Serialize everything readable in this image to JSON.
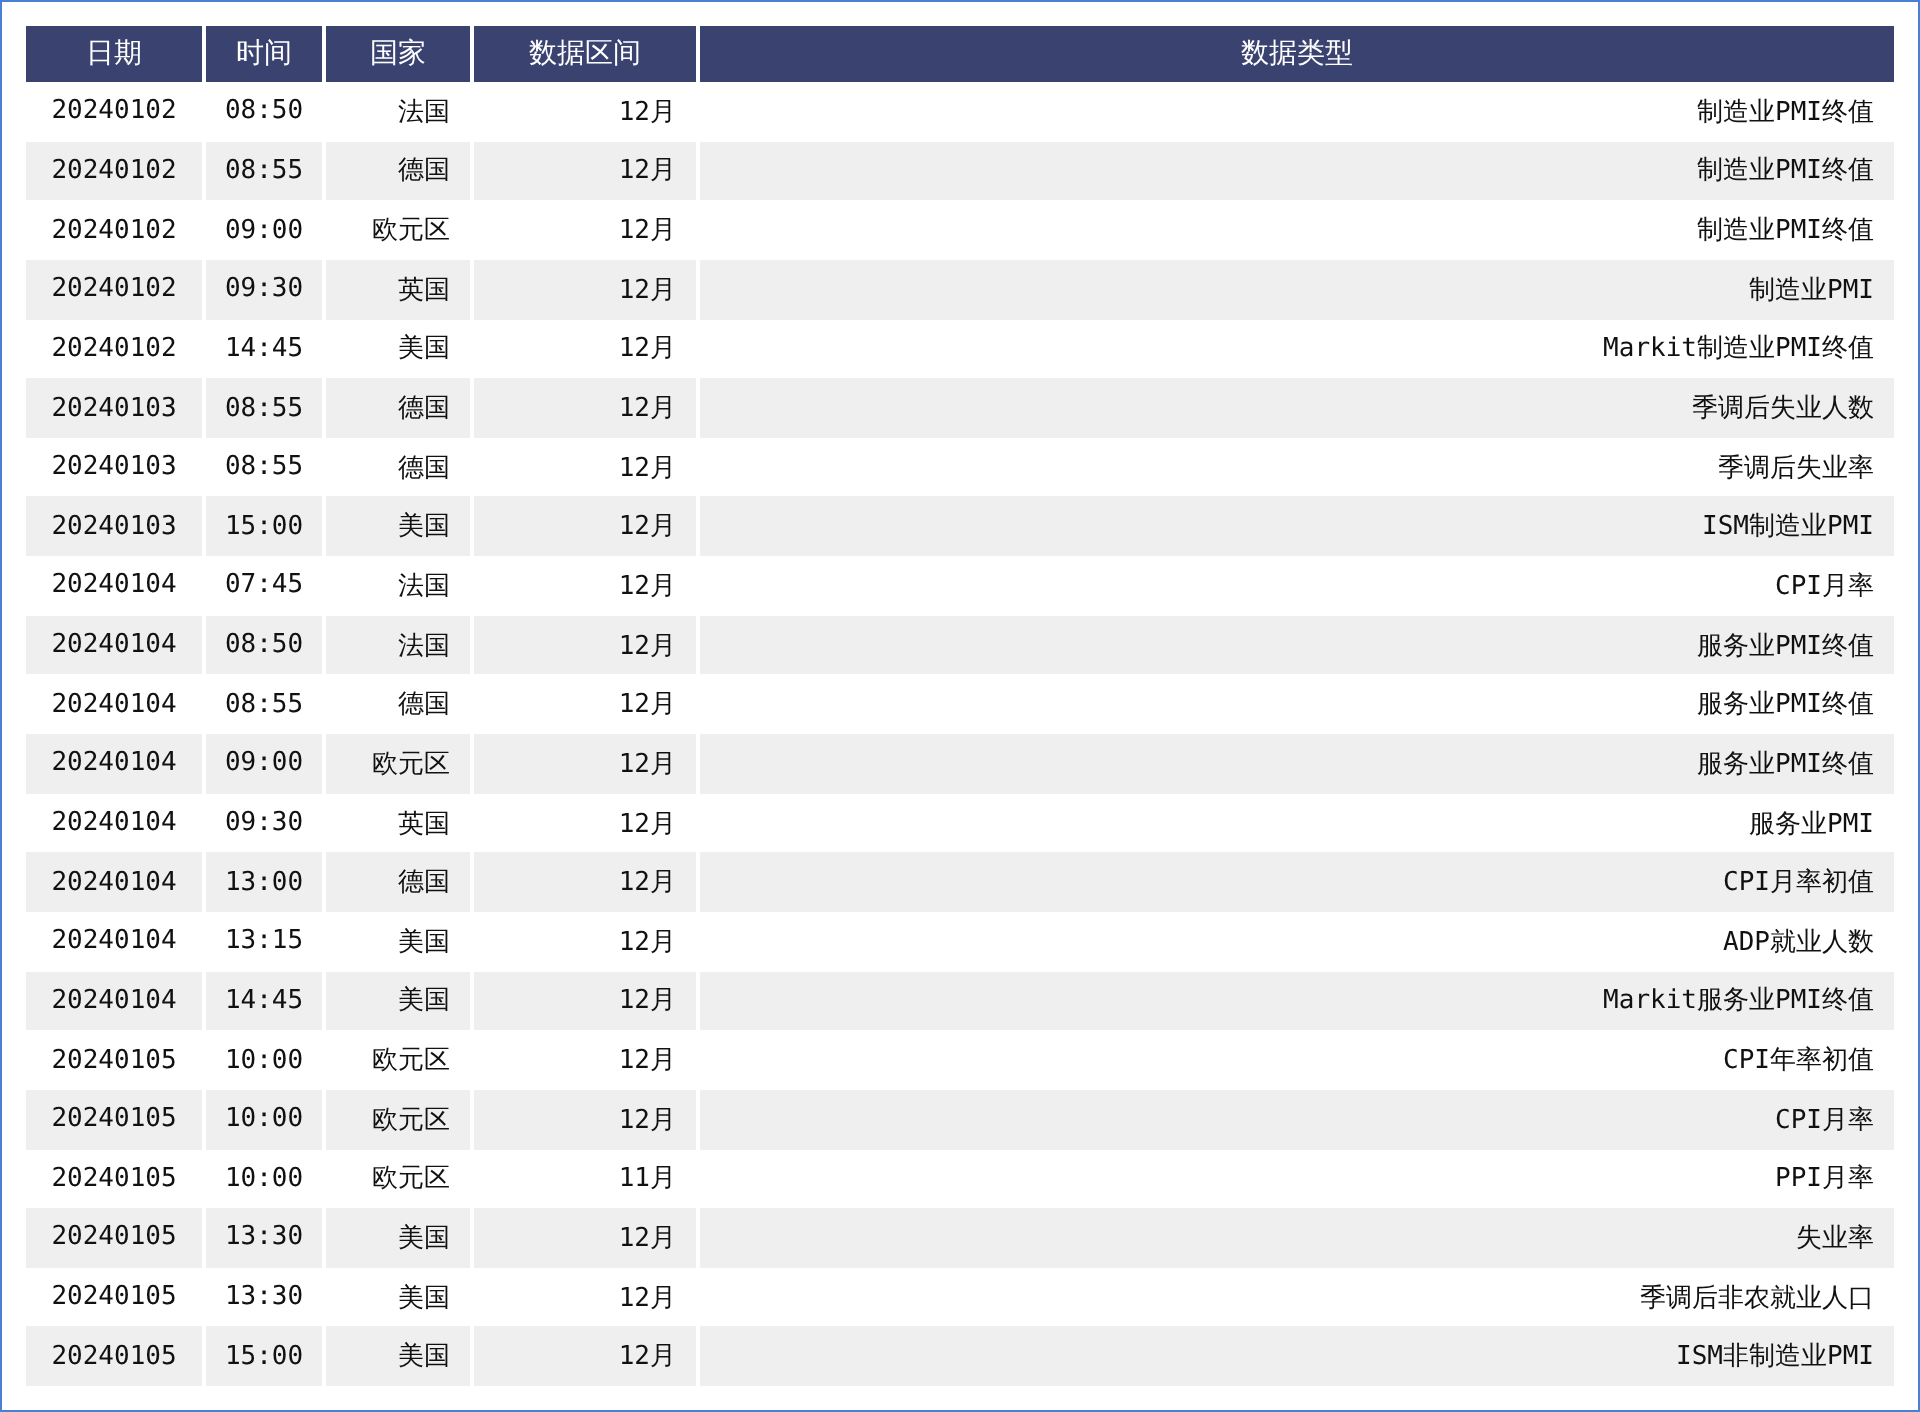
{
  "table": {
    "columns": [
      "日期",
      "时间",
      "国家",
      "数据区间",
      "数据类型"
    ],
    "rows": [
      [
        "20240102",
        "08:50",
        "法国",
        "12月",
        "制造业PMI终值"
      ],
      [
        "20240102",
        "08:55",
        "德国",
        "12月",
        "制造业PMI终值"
      ],
      [
        "20240102",
        "09:00",
        "欧元区",
        "12月",
        "制造业PMI终值"
      ],
      [
        "20240102",
        "09:30",
        "英国",
        "12月",
        "制造业PMI"
      ],
      [
        "20240102",
        "14:45",
        "美国",
        "12月",
        "Markit制造业PMI终值"
      ],
      [
        "20240103",
        "08:55",
        "德国",
        "12月",
        "季调后失业人数"
      ],
      [
        "20240103",
        "08:55",
        "德国",
        "12月",
        "季调后失业率"
      ],
      [
        "20240103",
        "15:00",
        "美国",
        "12月",
        "ISM制造业PMI"
      ],
      [
        "20240104",
        "07:45",
        "法国",
        "12月",
        "CPI月率"
      ],
      [
        "20240104",
        "08:50",
        "法国",
        "12月",
        "服务业PMI终值"
      ],
      [
        "20240104",
        "08:55",
        "德国",
        "12月",
        "服务业PMI终值"
      ],
      [
        "20240104",
        "09:00",
        "欧元区",
        "12月",
        "服务业PMI终值"
      ],
      [
        "20240104",
        "09:30",
        "英国",
        "12月",
        "服务业PMI"
      ],
      [
        "20240104",
        "13:00",
        "德国",
        "12月",
        "CPI月率初值"
      ],
      [
        "20240104",
        "13:15",
        "美国",
        "12月",
        "ADP就业人数"
      ],
      [
        "20240104",
        "14:45",
        "美国",
        "12月",
        "Markit服务业PMI终值"
      ],
      [
        "20240105",
        "10:00",
        "欧元区",
        "12月",
        "CPI年率初值"
      ],
      [
        "20240105",
        "10:00",
        "欧元区",
        "12月",
        "CPI月率"
      ],
      [
        "20240105",
        "10:00",
        "欧元区",
        "11月",
        "PPI月率"
      ],
      [
        "20240105",
        "13:30",
        "美国",
        "12月",
        "失业率"
      ],
      [
        "20240105",
        "13:30",
        "美国",
        "12月",
        "季调后非农就业人口"
      ],
      [
        "20240105",
        "15:00",
        "美国",
        "12月",
        "ISM非制造业PMI"
      ]
    ]
  }
}
